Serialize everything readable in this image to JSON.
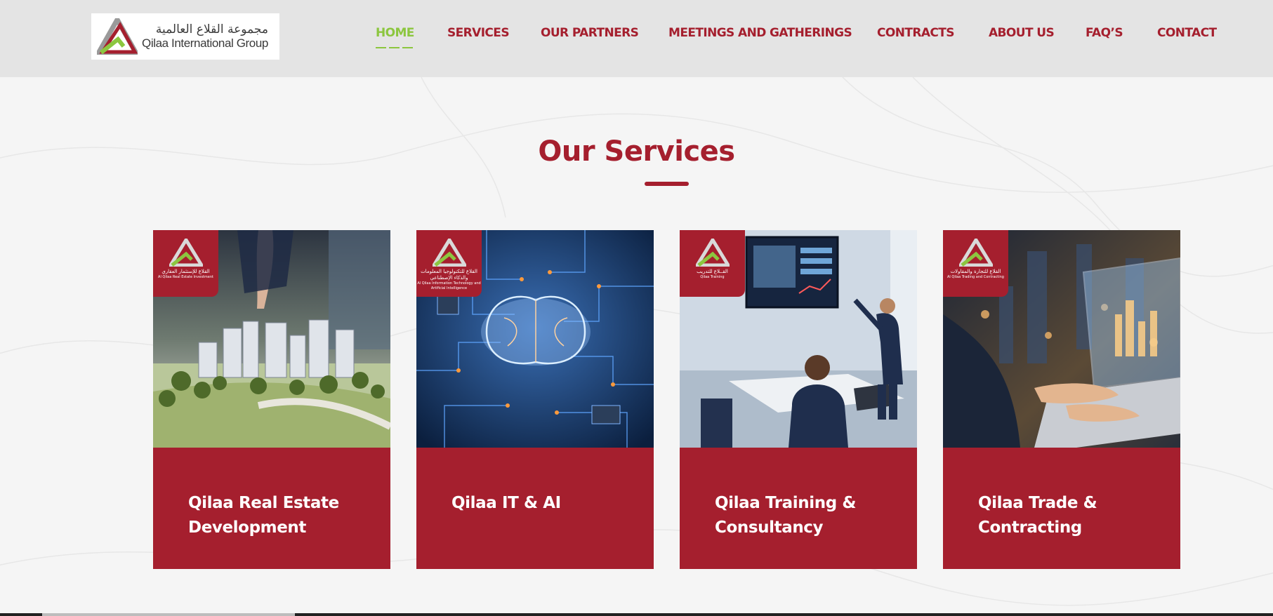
{
  "logo": {
    "arabic": "مجموعة القلاع العالمية",
    "english": "Qilaa International Group"
  },
  "nav": {
    "items": [
      {
        "label": "HOME",
        "active": true
      },
      {
        "label": "SERVICES"
      },
      {
        "label": "OUR PARTNERS"
      },
      {
        "label": "MEETINGS AND GATHERINGS"
      },
      {
        "label": "CONTRACTS"
      },
      {
        "label": "ABOUT US"
      },
      {
        "label": "FAQ’S"
      },
      {
        "label": "CONTACT"
      }
    ]
  },
  "services": {
    "title": "Our Services",
    "cards": [
      {
        "badge_ar": "القلاع للإستثمار العقاري",
        "badge_en": "Al Qilaa Real Estate Investment",
        "title": "Qilaa Real Estate Development",
        "image_icon": "city-model-icon"
      },
      {
        "badge_ar": "القلاع للتكنولوجيا المعلومات والذكاء الإصطناعي",
        "badge_en": "Al Qilaa Information Technology and Artificial Intelligence",
        "title": "Qilaa IT & AI",
        "image_icon": "circuit-brain-icon"
      },
      {
        "badge_ar": "القــلاع للتدريب",
        "badge_en": "Qilaa Training",
        "title": "Qilaa Training & Consultancy",
        "image_icon": "presentation-icon"
      },
      {
        "badge_ar": "القلاع للتجارة والمقاولات",
        "badge_en": "Al Qilaa Trading and Contracting",
        "title": "Qilaa Trade & Contracting",
        "image_icon": "laptop-city-icon"
      }
    ]
  },
  "colors": {
    "brand_red": "#a51f2e",
    "accent_green": "#8cc63f",
    "header_bg": "#e4e4e4",
    "page_bg": "#f5f5f5"
  }
}
